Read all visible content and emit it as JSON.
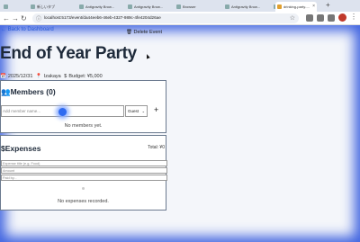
{
  "browser": {
    "tabs": [
      {
        "label": "",
        "active": false
      },
      {
        "label": "新しいタブ",
        "active": false
      },
      {
        "label": "Antigravity Brow...",
        "active": false
      },
      {
        "label": "Antigravity Brow...",
        "active": false
      },
      {
        "label": "Browser",
        "active": false
      },
      {
        "label": "Antigravity Brow...",
        "active": false
      },
      {
        "label": "Antigravity Brow...",
        "active": false
      },
      {
        "label": "drinking-party-...",
        "active": true
      }
    ],
    "url": "localhost:5173/event/da44eeb6-46eb-4327-989c-4fe4204d26ae",
    "url_icon": "ⓘ",
    "new_tab": "+",
    "back_icon": "←",
    "forward_icon": "→",
    "reload_icon": "↻",
    "star_icon": "☆",
    "menu_icon": "⋮"
  },
  "page": {
    "back_link": "Back to Dashboard",
    "back_arrow": "←",
    "delete_label": "Delete Event",
    "delete_icon": "🗑",
    "title": "End of Year Party",
    "date_icon": "📅",
    "date": "2025/12/31",
    "location_icon": "📍",
    "location": "Izakaya",
    "budget_icon": "$",
    "budget": "Budget: ¥5,000"
  },
  "members": {
    "icon": "👥",
    "title": "Members (0)",
    "input_placeholder": "Add member name...",
    "role_value": "Guest",
    "role_chevron": "⌄",
    "add_label": "+",
    "empty_text": "No members yet."
  },
  "expenses": {
    "icon": "$",
    "title": "Expenses",
    "total": "Total: ¥0",
    "title_placeholder": "Expense title (e.g. Food)",
    "amount_placeholder": "Amount",
    "paid_by_placeholder": "Paid by...",
    "empty_text": "No expenses recorded."
  }
}
